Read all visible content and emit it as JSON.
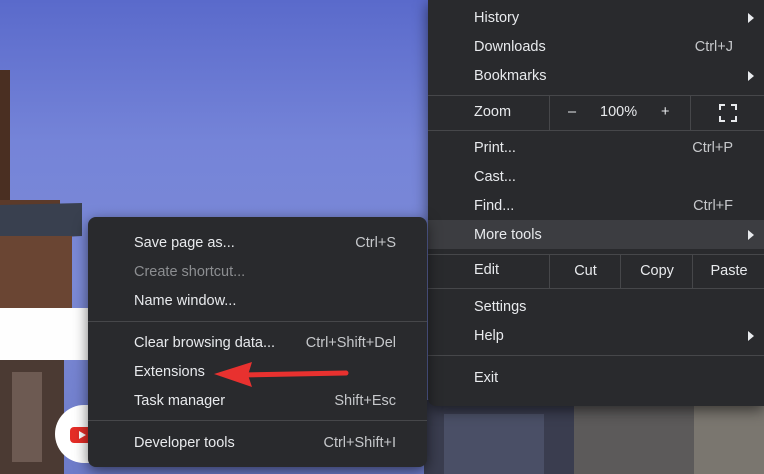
{
  "main_menu": {
    "history": {
      "label": "History"
    },
    "downloads": {
      "label": "Downloads",
      "shortcut": "Ctrl+J"
    },
    "bookmarks": {
      "label": "Bookmarks"
    },
    "zoom": {
      "label": "Zoom",
      "minus": "–",
      "value": "100%",
      "plus": "+"
    },
    "print": {
      "label": "Print...",
      "shortcut": "Ctrl+P"
    },
    "cast": {
      "label": "Cast..."
    },
    "find": {
      "label": "Find...",
      "shortcut": "Ctrl+F"
    },
    "more_tools": {
      "label": "More tools"
    },
    "edit": {
      "label": "Edit",
      "cut": "Cut",
      "copy": "Copy",
      "paste": "Paste"
    },
    "settings": {
      "label": "Settings"
    },
    "help": {
      "label": "Help"
    },
    "exit": {
      "label": "Exit"
    }
  },
  "sub_menu": {
    "save_page": {
      "label": "Save page as...",
      "shortcut": "Ctrl+S"
    },
    "create_shortcut": {
      "label": "Create shortcut..."
    },
    "name_window": {
      "label": "Name window..."
    },
    "clear_data": {
      "label": "Clear browsing data...",
      "shortcut": "Ctrl+Shift+Del"
    },
    "extensions": {
      "label": "Extensions"
    },
    "task_manager": {
      "label": "Task manager",
      "shortcut": "Shift+Esc"
    },
    "dev_tools": {
      "label": "Developer tools",
      "shortcut": "Ctrl+Shift+I"
    }
  },
  "colors": {
    "menu_bg": "#292a2d",
    "highlight": "#3c3d41",
    "annotation_arrow": "#e8312f"
  }
}
